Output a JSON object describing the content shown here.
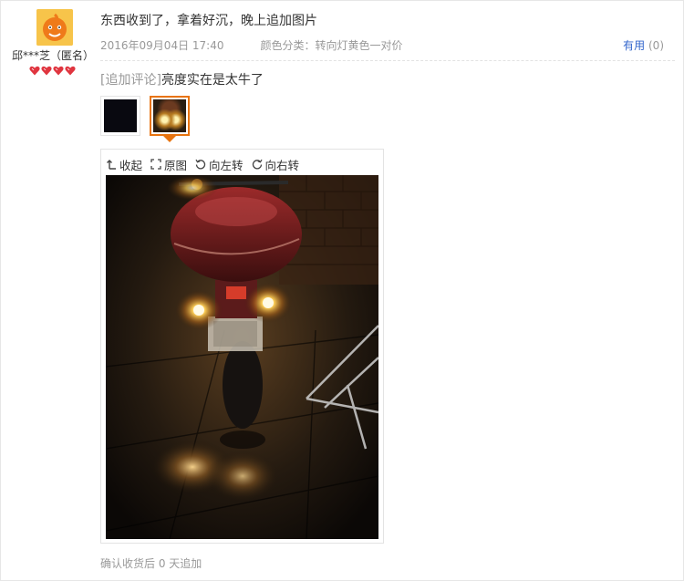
{
  "user": {
    "name": "邱***芝（匿名）",
    "level_icon": "heart-icon",
    "level_count": 4,
    "avatar_icon": "avatar-icon",
    "avatar_color": "#f7c44a"
  },
  "review": {
    "text": "东西收到了，拿着好沉，晚上追加图片",
    "date": "2016年09月04日 17:40",
    "attribute": "颜色分类：转向灯黄色一对价",
    "useful_label": "有用",
    "useful_count": "(0)"
  },
  "append": {
    "tag": "[追加评论]",
    "text": "亮度实在是太牛了"
  },
  "viewer": {
    "collapse_label": "收起",
    "original_label": "原图",
    "rotate_left_label": "向左转",
    "rotate_right_label": "向右转",
    "selected_thumb": 2
  },
  "footer": {
    "text": "确认收货后 0 天追加"
  },
  "colors": {
    "accent": "#e8740f",
    "link": "#3366cc",
    "muted": "#999999"
  }
}
